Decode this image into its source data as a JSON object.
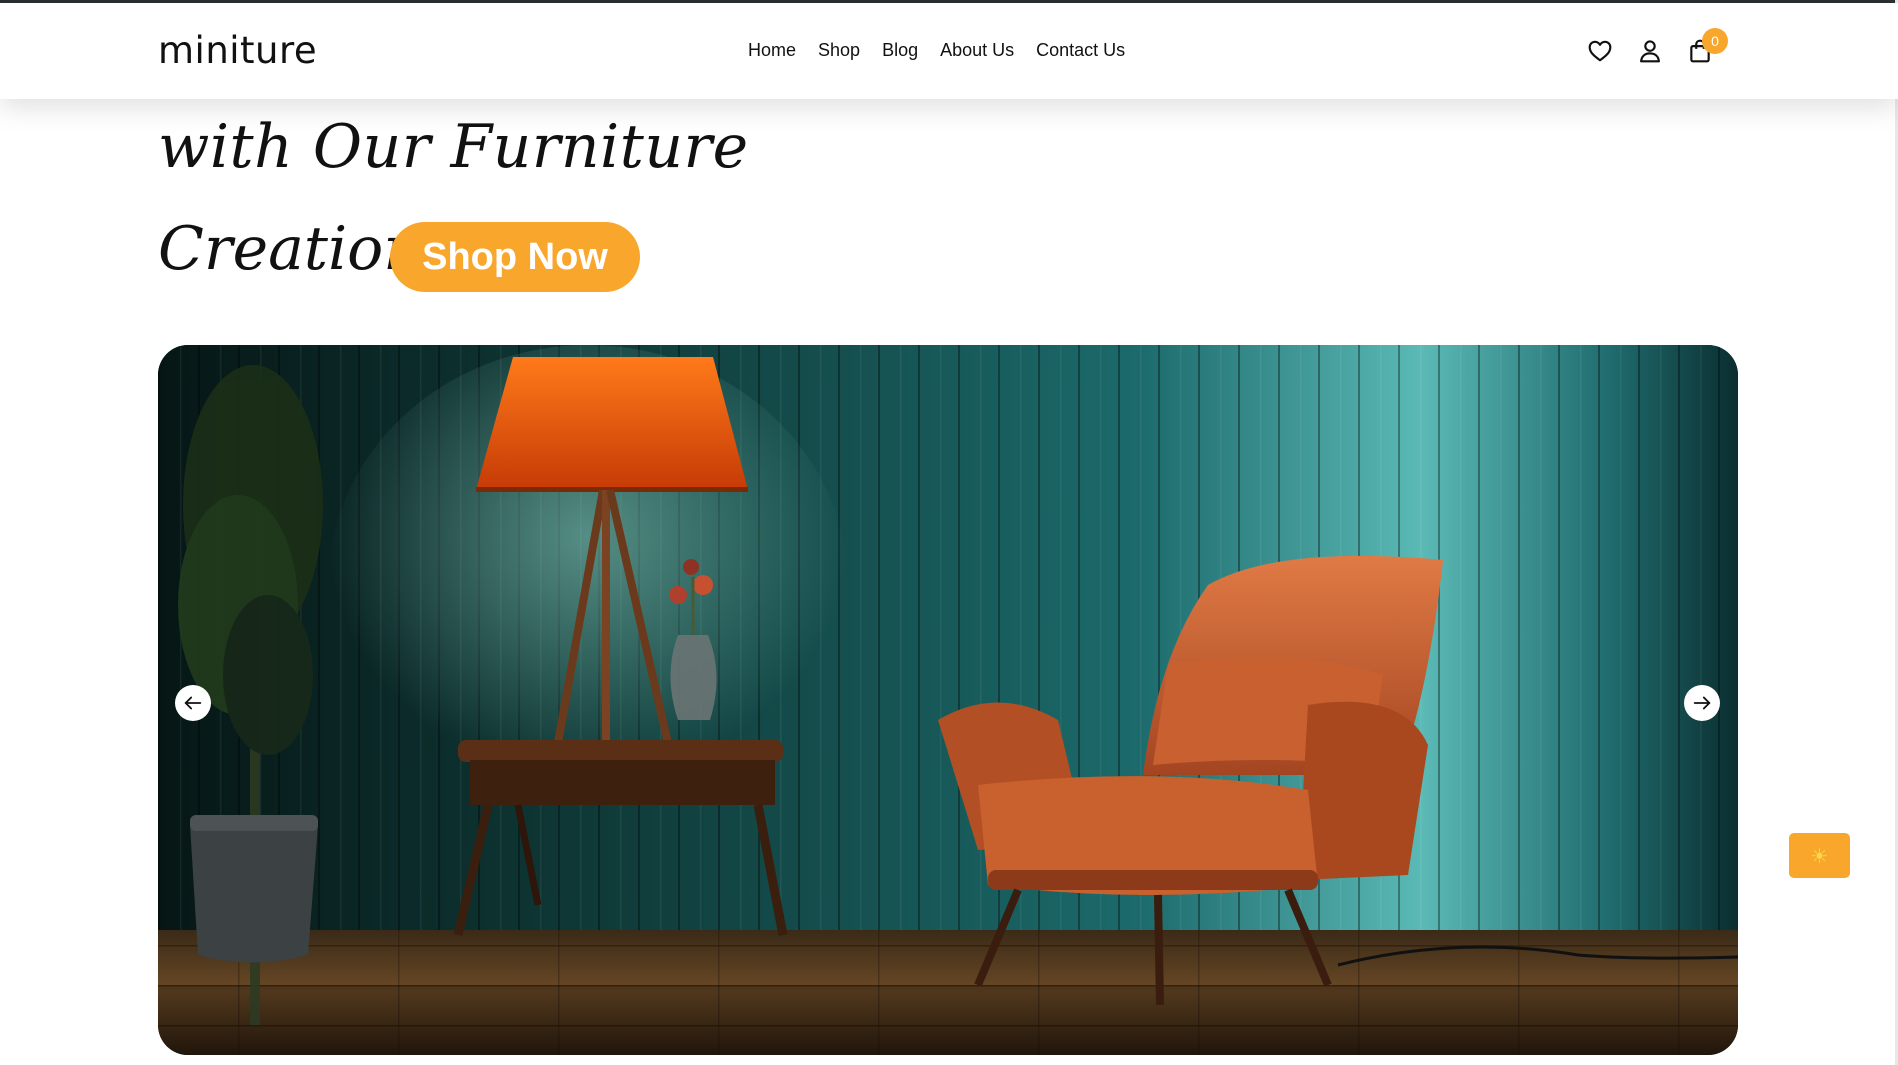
{
  "brand": {
    "logo": "miniture"
  },
  "nav": {
    "items": [
      {
        "label": "Home"
      },
      {
        "label": "Shop"
      },
      {
        "label": "Blog"
      },
      {
        "label": "About Us"
      },
      {
        "label": "Contact Us"
      }
    ]
  },
  "header_icons": {
    "wishlist": "heart-icon",
    "account": "user-icon",
    "cart": "shopping-bag-icon",
    "cart_count": "0"
  },
  "hero": {
    "line1": "with Our Furniture",
    "line2": "Creations",
    "cta_label": "Shop Now"
  },
  "slider": {
    "prev_icon": "arrow-left-icon",
    "next_icon": "arrow-right-icon",
    "image_alt": "Orange lounge chair beside a side table with a lamp and vase against a teal paneled wall"
  },
  "theme_toggle": {
    "icon": "sun-icon",
    "glyph": "☀"
  },
  "colors": {
    "accent": "#f9a62d",
    "text": "#111111",
    "background": "#ffffff",
    "wall": "#0f3e40"
  }
}
